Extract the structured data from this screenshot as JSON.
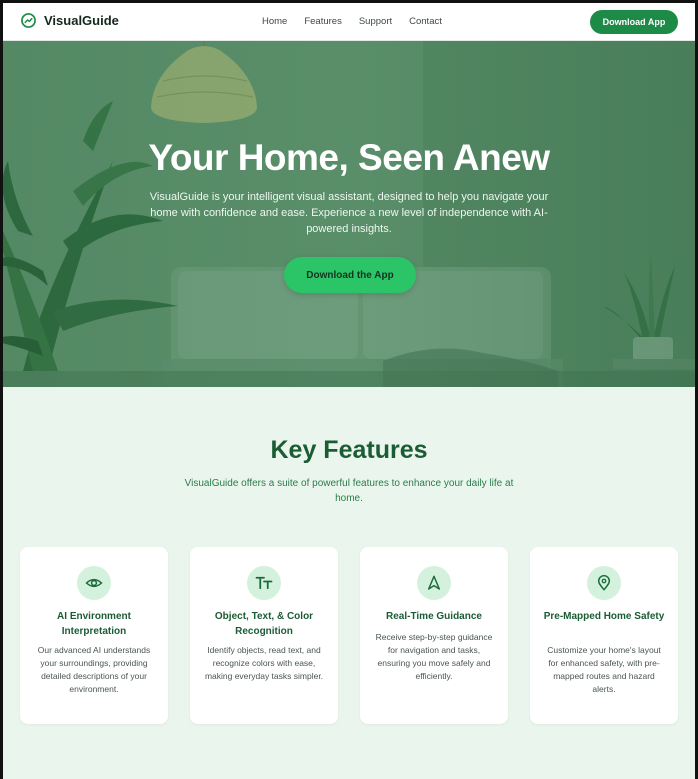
{
  "header": {
    "brand": "VisualGuide",
    "nav": [
      "Home",
      "Features",
      "Support",
      "Contact"
    ],
    "download_button": "Download App"
  },
  "hero": {
    "title": "Your Home, Seen Anew",
    "subtitle": "VisualGuide is your intelligent visual assistant, designed to help you navigate your home with confidence and ease. Experience a new level of independence with AI-powered insights.",
    "cta": "Download the App"
  },
  "features": {
    "title": "Key Features",
    "subtitle": "VisualGuide offers a suite of powerful features to enhance your daily life at home.",
    "cards": [
      {
        "icon": "eye-icon",
        "title": "AI Environment Interpretation",
        "desc": "Our advanced AI understands your surroundings, providing detailed descriptions of your environment."
      },
      {
        "icon": "text-icon",
        "title": "Object, Text, & Color Recognition",
        "desc": "Identify objects, read text, and recognize colors with ease, making everyday tasks simpler."
      },
      {
        "icon": "navigation-icon",
        "title": "Real-Time Guidance",
        "desc": "Receive step-by-step guidance for navigation and tasks, ensuring you move safely and efficiently."
      },
      {
        "icon": "map-pin-icon",
        "title": "Pre-Mapped Home Safety",
        "desc": "Customize your home's layout for enhanced safety, with pre-mapped routes and hazard alerts."
      }
    ]
  },
  "colors": {
    "brand_green": "#1e8a47",
    "cta_green": "#2bc567",
    "heading_green": "#1b5c34",
    "section_bg": "#eaf6ed"
  }
}
